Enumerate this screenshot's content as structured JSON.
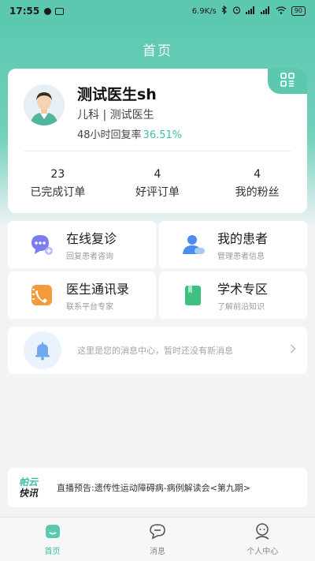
{
  "status_bar": {
    "time": "17:55",
    "network_speed": "6.9K/s",
    "battery": "90"
  },
  "header": {
    "title": "首页"
  },
  "profile": {
    "name": "测试医生sh",
    "department": "儿科 | 测试医生",
    "reply_rate_label": "48小时回复率",
    "reply_rate_value": "36.51%"
  },
  "stats": [
    {
      "value": "23",
      "label": "已完成订单"
    },
    {
      "value": "4",
      "label": "好评订单"
    },
    {
      "value": "4",
      "label": "我的粉丝"
    }
  ],
  "menu": [
    {
      "title": "在线复诊",
      "subtitle": "回复患者咨询",
      "icon": "chat-bubble-icon",
      "color": "#7b7cf0"
    },
    {
      "title": "我的患者",
      "subtitle": "管理患者信息",
      "icon": "patient-icon",
      "color": "#4a8df0"
    },
    {
      "title": "医生通讯录",
      "subtitle": "联系平台专家",
      "icon": "phone-book-icon",
      "color": "#f39a3b"
    },
    {
      "title": "学术专区",
      "subtitle": "了解前沿知识",
      "icon": "book-icon",
      "color": "#3dbf7e"
    }
  ],
  "message_center": {
    "text": "这里是您的消息中心，暂时还没有新消息",
    "icon": "bell-icon"
  },
  "news": {
    "logo_line1": "帕云",
    "logo_line2": "快讯",
    "text": "直播预告:遗传性运动障碍病-病例解读会<第九期>"
  },
  "tabs": [
    {
      "label": "首页",
      "icon": "home-icon",
      "active": true
    },
    {
      "label": "消息",
      "icon": "message-icon",
      "active": false
    },
    {
      "label": "个人中心",
      "icon": "profile-icon",
      "active": false
    }
  ],
  "colors": {
    "accent": "#5cc8b0",
    "accent_text": "#3cbfa4",
    "background": "#f2f3f5"
  }
}
